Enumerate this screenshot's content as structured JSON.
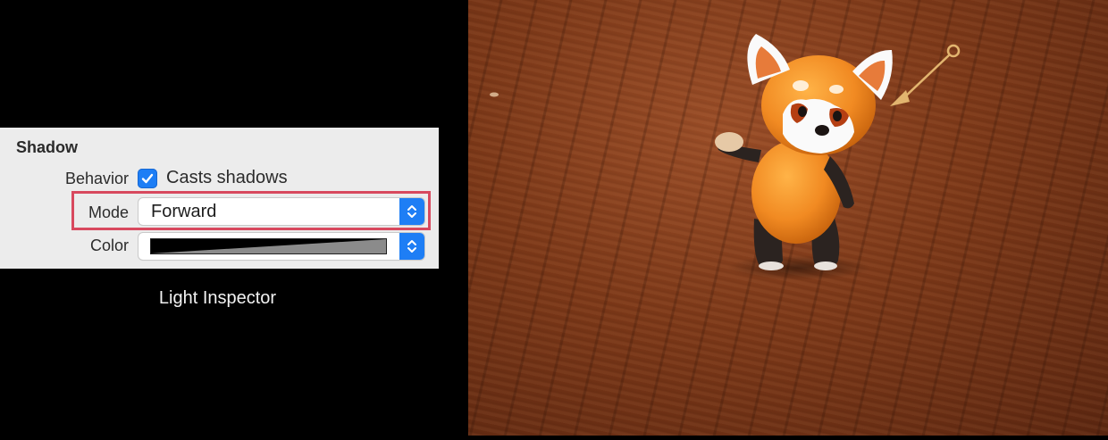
{
  "inspector": {
    "section_title": "Shadow",
    "behavior": {
      "label": "Behavior",
      "checkbox_checked": true,
      "checkbox_label": "Casts shadows"
    },
    "mode": {
      "label": "Mode",
      "selected_value": "Forward"
    },
    "color": {
      "label": "Color"
    },
    "caption": "Light Inspector"
  },
  "colors": {
    "accent": "#1e7ef5",
    "highlight": "#d8495e",
    "panel_bg": "#ececec",
    "floor": "#7c3818",
    "panda_fur": "#f18a22",
    "light_arrow": "#e2b56f"
  },
  "icons": {
    "checkbox": "checkmark-icon",
    "stepper": "up-down-chevron-icon"
  },
  "viewport": {
    "scene": "ar-red-panda-on-wood-floor",
    "light_gizmo": "directional-light-arrow"
  }
}
